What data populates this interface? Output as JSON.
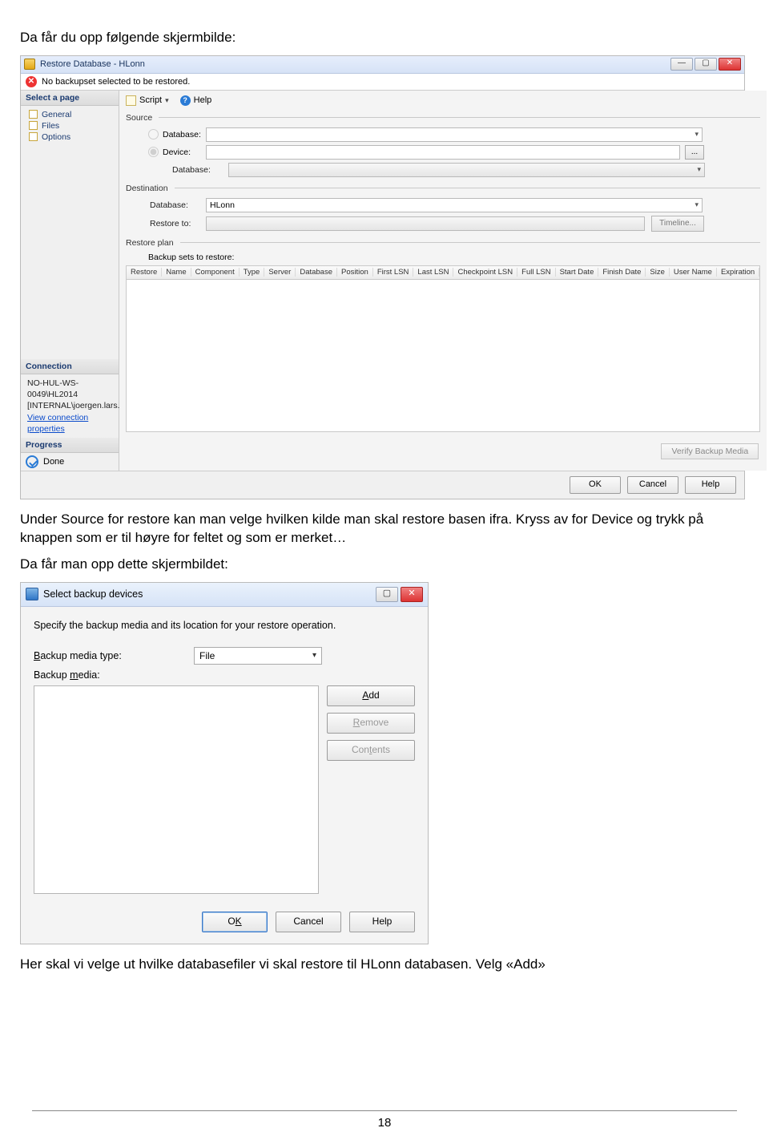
{
  "document": {
    "intro": "Da får du opp følgende skjermbilde:",
    "para1": "Under Source for restore kan man velge hvilken kilde man skal restore basen ifra. Kryss av for Device og trykk på knappen som er til høyre for feltet og som er merket…",
    "para2": "Da får man opp dette skjermbildet:",
    "para3": "Her skal vi velge ut hvilke databasefiler vi skal restore til HLonn databasen. Velg «Add»",
    "page_number": "18"
  },
  "restore_window": {
    "title": "Restore Database - HLonn",
    "alert": "No backupset selected to be restored.",
    "side": {
      "select_page": "Select a page",
      "pages": [
        "General",
        "Files",
        "Options"
      ],
      "connection_hd": "Connection",
      "server": "NO-HUL-WS-0049\\HL2014",
      "user": "[INTERNAL\\joergen.lars.",
      "view_props": "View connection properties",
      "progress_hd": "Progress",
      "progress_state": "Done"
    },
    "toolbar": {
      "script": "Script",
      "help": "Help"
    },
    "source": {
      "header": "Source",
      "database_label": "Database:",
      "device_label": "Device:",
      "db2_label": "Database:",
      "ellipsis": "..."
    },
    "destination": {
      "header": "Destination",
      "database_label": "Database:",
      "database_value": "HLonn",
      "restore_to_label": "Restore to:",
      "timeline": "Timeline..."
    },
    "plan": {
      "header": "Restore plan",
      "sets_label": "Backup sets to restore:",
      "columns": [
        "Restore",
        "Name",
        "Component",
        "Type",
        "Server",
        "Database",
        "Position",
        "First LSN",
        "Last LSN",
        "Checkpoint LSN",
        "Full LSN",
        "Start Date",
        "Finish Date",
        "Size",
        "User Name",
        "Expiration"
      ]
    },
    "verify_btn": "Verify Backup Media",
    "footer": {
      "ok": "OK",
      "cancel": "Cancel",
      "help": "Help"
    }
  },
  "select_dialog": {
    "title": "Select backup devices",
    "desc": "Specify the backup media and its location for your restore operation.",
    "media_type_label_pre": "B",
    "media_type_label_rest": "ackup media type:",
    "media_type_value": "File",
    "media_label_pre": "Backup ",
    "media_label_u": "m",
    "media_label_rest": "edia:",
    "buttons": {
      "add_pre": "A",
      "add_rest": "dd",
      "remove_pre": "R",
      "remove_rest": "emove",
      "contents_pre": "Con",
      "contents_u": "t",
      "contents_rest": "ents"
    },
    "footer": {
      "ok_pre": "O",
      "ok_u": "K",
      "cancel": "Cancel",
      "help": "Help"
    }
  }
}
